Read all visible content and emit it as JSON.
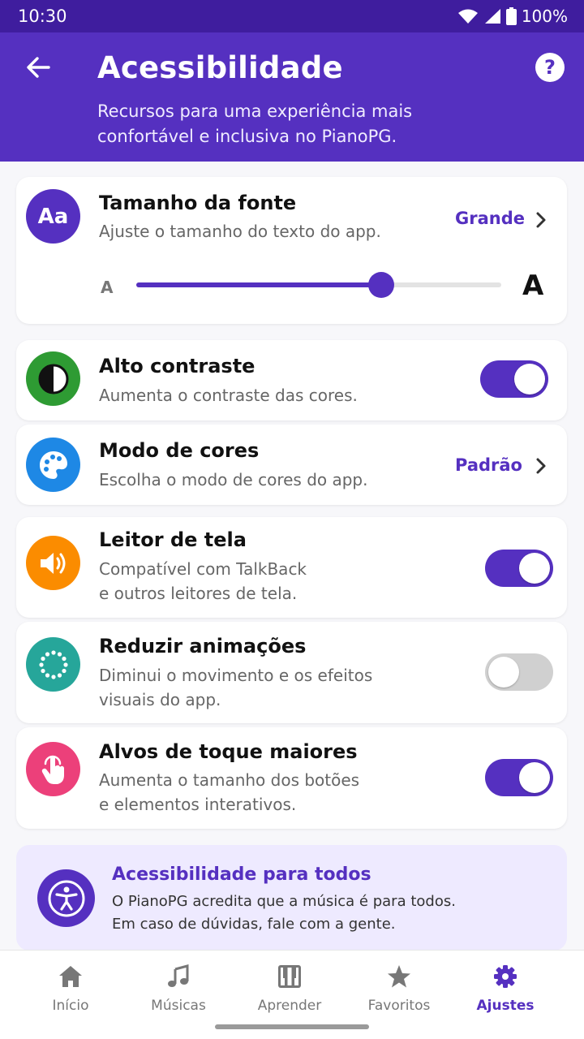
{
  "status_bar": {
    "time": "10:30",
    "battery": "100%"
  },
  "header": {
    "title": "Acessibilidade",
    "subtitle": "Recursos para uma experiência mais confortável e inclusiva no PianoPG.",
    "back_icon": "arrow-back-icon",
    "help_icon": "help-icon",
    "help_glyph": "?"
  },
  "font_size": {
    "icon_text": "Aa",
    "title": "Tamanho da fonte",
    "subtitle": "Ajuste o tamanho do texto do app.",
    "value": "Grande",
    "slider_small_label": "A",
    "slider_large_label": "A",
    "slider_level": 0.67
  },
  "settings": [
    {
      "id": "high-contrast",
      "title": "Alto contraste",
      "subtitle": "Aumenta o contraste das cores.",
      "control": "toggle",
      "on": true,
      "icon": "contrast-icon",
      "color": "#2e9b33"
    },
    {
      "id": "color-mode",
      "title": "Modo de cores",
      "subtitle": "Escolha o modo de cores do app.",
      "control": "select",
      "value": "Padrão",
      "icon": "palette-icon",
      "color": "#1e88e5"
    },
    {
      "id": "screen-reader",
      "title": "Leitor de tela",
      "subtitle_lines": [
        "Compatível com TalkBack",
        "e outros leitores de tela."
      ],
      "control": "toggle",
      "on": true,
      "icon": "speaker-icon",
      "color": "#fb8c00"
    },
    {
      "id": "reduce-animations",
      "title": "Reduzir animações",
      "subtitle_lines": [
        "Diminui o movimento e os efeitos",
        "visuais do app."
      ],
      "control": "toggle",
      "on": false,
      "icon": "dotted-circle-icon",
      "color": "#26a69a"
    },
    {
      "id": "larger-targets",
      "title": "Alvos de toque maiores",
      "subtitle_lines": [
        "Aumenta o tamanho dos botões",
        "e elementos interativos."
      ],
      "control": "toggle",
      "on": true,
      "icon": "touch-icon",
      "color": "#ec407a"
    }
  ],
  "info_card": {
    "title": "Acessibilidade para todos",
    "lines": [
      "O PianoPG acredita que a música é para todos.",
      "Em caso de dúvidas, fale com a gente."
    ],
    "icon": "accessibility-icon"
  },
  "bottom_nav": [
    {
      "label": "Início",
      "icon": "home-icon",
      "active": false
    },
    {
      "label": "Músicas",
      "icon": "music-note-icon",
      "active": false
    },
    {
      "label": "Aprender",
      "icon": "piano-icon",
      "active": false
    },
    {
      "label": "Favoritos",
      "icon": "star-icon",
      "active": false
    },
    {
      "label": "Ajustes",
      "icon": "gear-icon",
      "active": true
    }
  ],
  "colors": {
    "primary": "#5530c0",
    "status_bar": "#3f1d9e",
    "inactive": "#777777"
  }
}
